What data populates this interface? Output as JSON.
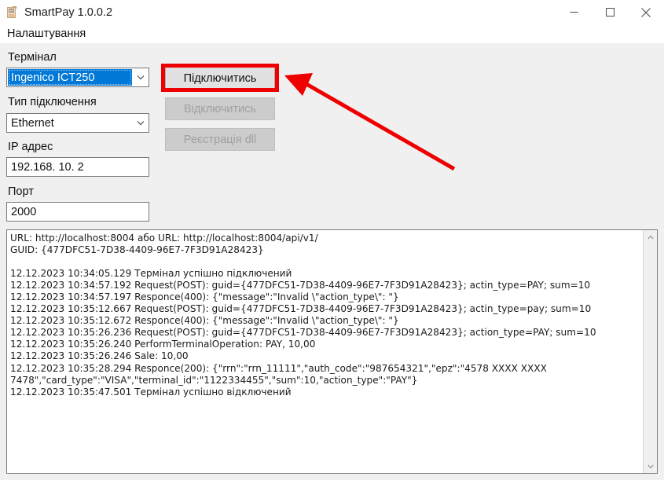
{
  "window": {
    "title": "SmartPay 1.0.0.2",
    "icon": "payment-terminal-icon",
    "icon_glyph": "S",
    "controls": {
      "minimize": "minimize-icon",
      "maximize": "maximize-icon",
      "close": "close-icon"
    }
  },
  "menu": {
    "settings_label": "Налаштування"
  },
  "form": {
    "terminal": {
      "label": "Термінал",
      "value": "Ingenico ICT250",
      "options": [
        "Ingenico ICT250"
      ]
    },
    "connection_type": {
      "label": "Тип підключення",
      "value": "Ethernet",
      "options": [
        "Ethernet"
      ]
    },
    "ip_address": {
      "label": "IP адрес",
      "value": "192.168. 10.  2"
    },
    "port": {
      "label": "Порт",
      "value": "2000"
    }
  },
  "buttons": {
    "connect": {
      "label": "Підключитись",
      "enabled": true
    },
    "disconnect": {
      "label": "Відключитись",
      "enabled": false
    },
    "register_dll": {
      "label": "Реєстрація dll",
      "enabled": false
    }
  },
  "log": {
    "lines": [
      "URL: http://localhost:8004 або URL: http://localhost:8004/api/v1/",
      "GUID: {477DFC51-7D38-4409-96E7-7F3D91A28423}",
      "",
      "12.12.2023 10:34:05.129 Термінал успішно підключений",
      "12.12.2023 10:34:57.192 Request(POST): guid={477DFC51-7D38-4409-96E7-7F3D91A28423}; actin_type=PAY; sum=10",
      "12.12.2023 10:34:57.197 Responce(400): {\"message\":\"Invalid \\\"action_type\\\": \"}",
      "12.12.2023 10:35:12.667 Request(POST): guid={477DFC51-7D38-4409-96E7-7F3D91A28423}; actin_type=pay; sum=10",
      "12.12.2023 10:35:12.672 Responce(400): {\"message\":\"Invalid \\\"action_type\\\": \"}",
      "12.12.2023 10:35:26.236 Request(POST): guid={477DFC51-7D38-4409-96E7-7F3D91A28423}; action_type=PAY; sum=10",
      "12.12.2023 10:35:26.240 PerformTerminalOperation: PAY, 10,00",
      "12.12.2023 10:35:26.246 Sale: 10,00",
      "12.12.2023 10:35:28.294 Responce(200): {\"rrn\":\"rrn_11111\",\"auth_code\":\"987654321\",\"epz\":\"4578 XXXX XXXX",
      "7478\",\"card_type\":\"VISA\",\"terminal_id\":\"1122334455\",\"sum\":10,\"action_type\":\"PAY\"}",
      "12.12.2023 10:35:47.501 Термінал успішно відключений"
    ],
    "text": "URL: http://localhost:8004 або URL: http://localhost:8004/api/v1/\nGUID: {477DFC51-7D38-4409-96E7-7F3D91A28423}\n\n12.12.2023 10:34:05.129 Термінал успішно підключений\n12.12.2023 10:34:57.192 Request(POST): guid={477DFC51-7D38-4409-96E7-7F3D91A28423}; actin_type=PAY; sum=10\n12.12.2023 10:34:57.197 Responce(400): {\"message\":\"Invalid \\\"action_type\\\": \"}\n12.12.2023 10:35:12.667 Request(POST): guid={477DFC51-7D38-4409-96E7-7F3D91A28423}; actin_type=pay; sum=10\n12.12.2023 10:35:12.672 Responce(400): {\"message\":\"Invalid \\\"action_type\\\": \"}\n12.12.2023 10:35:26.236 Request(POST): guid={477DFC51-7D38-4409-96E7-7F3D91A28423}; action_type=PAY; sum=10\n12.12.2023 10:35:26.240 PerformTerminalOperation: PAY, 10,00\n12.12.2023 10:35:26.246 Sale: 10,00\n12.12.2023 10:35:28.294 Responce(200): {\"rrn\":\"rrn_11111\",\"auth_code\":\"987654321\",\"epz\":\"4578 XXXX XXXX\n7478\",\"card_type\":\"VISA\",\"terminal_id\":\"1122334455\",\"sum\":10,\"action_type\":\"PAY\"}\n12.12.2023 10:35:47.501 Термінал успішно відключений",
    "scrollbar": {
      "up_arrow": "chevron-up-icon",
      "down_arrow": "chevron-down-icon"
    }
  },
  "annotation": {
    "highlight_color": "#ef0000",
    "arrow_color": "#ef0000",
    "target": "connect-button"
  },
  "colors": {
    "window_bg": "#f0f0f0",
    "titlebar_bg": "#ffffff",
    "selection_blue": "#0078d7",
    "field_border": "#7a7a7a",
    "button_face": "#e1e1e1",
    "button_disabled": "#cccccc",
    "text": "#111111"
  }
}
